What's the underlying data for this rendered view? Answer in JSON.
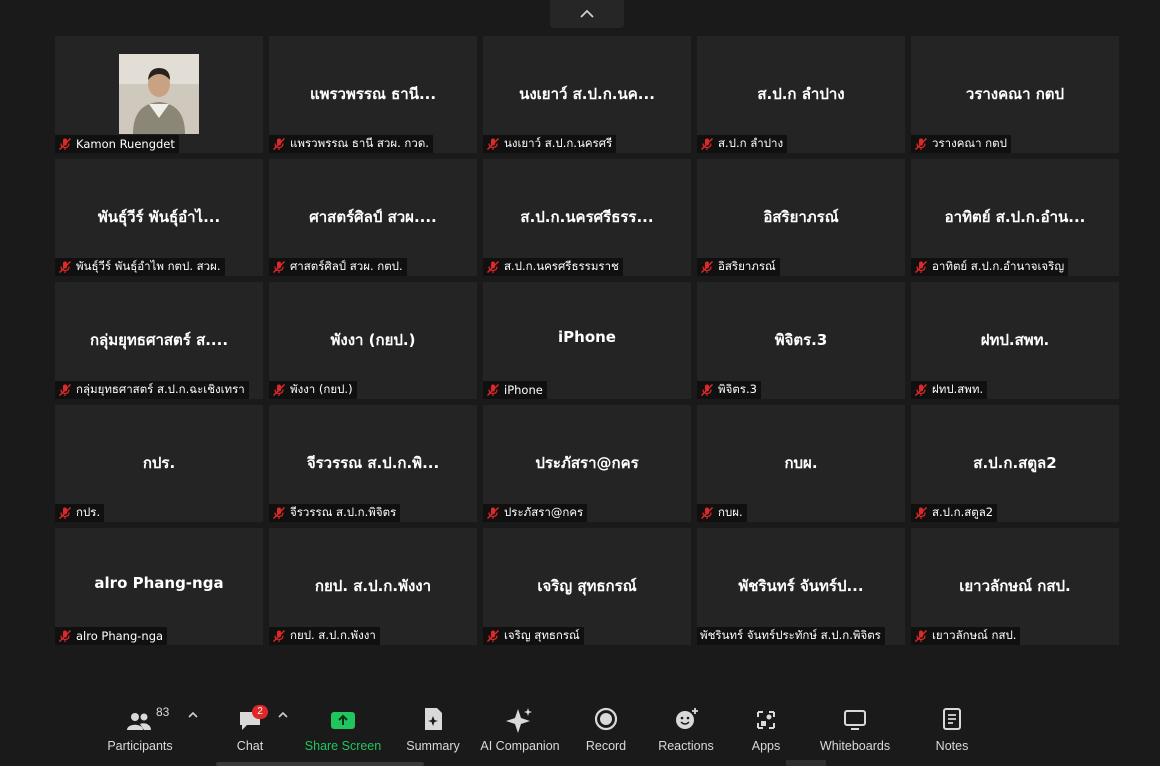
{
  "participants_grid": [
    {
      "name": "",
      "label": "Kamon Ruengdet",
      "has_photo": true
    },
    {
      "name": "แพรวพรรณ ธานี...",
      "label": "แพรวพรรณ ธานี สวผ. กวด."
    },
    {
      "name": "นงเยาว์ ส.ป.ก.นค...",
      "label": "นงเยาว์ ส.ป.ก.นครศรี"
    },
    {
      "name": "ส.ป.ก ลำปาง",
      "label": "ส.ป.ก ลำปาง"
    },
    {
      "name": "วรางคณา กตป",
      "label": "วรางคณา กตป"
    },
    {
      "name": "พันธุ์วีร์ พันธุ์อำไ...",
      "label": "พันธุ์วีร์ พันธุ์อำไพ กตป. สวผ."
    },
    {
      "name": "ศาสตร์ศิลป์ สวผ....",
      "label": "ศาสตร์ศิลป์ สวผ. กตป."
    },
    {
      "name": "ส.ป.ก.นครศรีธรร...",
      "label": "ส.ป.ก.นครศรีธรรมราช"
    },
    {
      "name": "อิสริยาภรณ์",
      "label": "อิสริยาภรณ์"
    },
    {
      "name": "อาทิตย์ ส.ป.ก.อำน...",
      "label": "อาทิตย์ ส.ป.ก.อำนาจเจริญ"
    },
    {
      "name": "กลุ่มยุทธศาสตร์ ส....",
      "label": "กลุ่มยุทธศาสตร์ ส.ป.ก.ฉะเชิงเทรา"
    },
    {
      "name": "พังงา (กยป.)",
      "label": "พังงา (กยป.)"
    },
    {
      "name": "iPhone",
      "label": "iPhone"
    },
    {
      "name": "พิจิตร.3",
      "label": "พิจิตร.3"
    },
    {
      "name": "ฝทป.สพท.",
      "label": "ฝทป.สพท."
    },
    {
      "name": "กปร.",
      "label": "กปร."
    },
    {
      "name": "จีรวรรณ ส.ป.ก.พิ...",
      "label": "จีรวรรณ ส.ป.ก.พิจิตร"
    },
    {
      "name": "ประภัสรา@กคร",
      "label": "ประภัสรา@กคร"
    },
    {
      "name": "กบผ.",
      "label": "กบผ."
    },
    {
      "name": "ส.ป.ก.สตูล2",
      "label": "ส.ป.ก.สตูล2"
    },
    {
      "name": "alro Phang-nga",
      "label": "alro Phang-nga"
    },
    {
      "name": "กยป. ส.ป.ก.พังงา",
      "label": "กยป. ส.ป.ก.พังงา"
    },
    {
      "name": "เจริญ สุทธกรณ์",
      "label": "เจริญ สุทธกรณ์"
    },
    {
      "name": "พัชรินทร์ จันทร์ป...",
      "label": "พัชรินทร์ จันทร์ประทักษ์ ส.ป.ก.พิจิตร",
      "unmuted_label": true
    },
    {
      "name": "เยาวลักษณ์ กสป.",
      "label": "เยาวลักษณ์ กสป."
    }
  ],
  "toolbar": {
    "participants": {
      "label": "Participants",
      "count": "83"
    },
    "chat": {
      "label": "Chat",
      "badge": "2"
    },
    "share": {
      "label": "Share Screen"
    },
    "summary": {
      "label": "Summary"
    },
    "ai": {
      "label": "AI Companion"
    },
    "record": {
      "label": "Record"
    },
    "reactions": {
      "label": "Reactions"
    },
    "apps": {
      "label": "Apps"
    },
    "whiteboards": {
      "label": "Whiteboards"
    },
    "notes": {
      "label": "Notes"
    }
  },
  "colors": {
    "background": "#1a1a1a",
    "tile": "#242424",
    "mute_red": "#e02828",
    "share_green": "#21c55e"
  }
}
